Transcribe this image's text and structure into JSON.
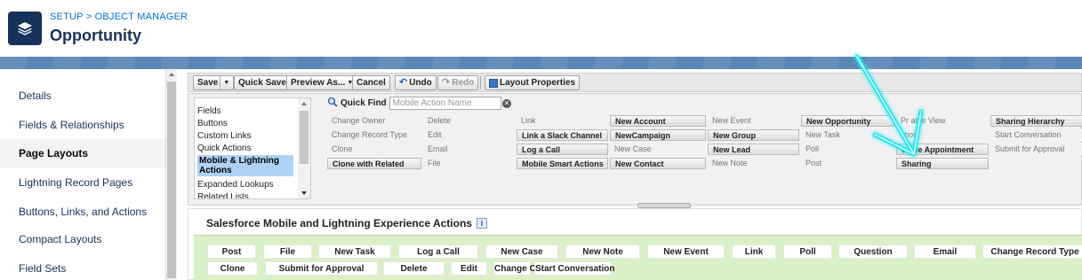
{
  "header": {
    "breadcrumb_setup": "SETUP",
    "breadcrumb_sep": " > ",
    "breadcrumb_om": "OBJECT MANAGER",
    "title": "Opportunity",
    "icon": "layers-icon"
  },
  "sidebar": {
    "items": [
      {
        "label": "Details"
      },
      {
        "label": "Fields & Relationships"
      },
      {
        "label": "Page Layouts"
      },
      {
        "label": "Lightning Record Pages"
      },
      {
        "label": "Buttons, Links, and Actions"
      },
      {
        "label": "Compact Layouts"
      },
      {
        "label": "Field Sets"
      }
    ],
    "active_index": 2
  },
  "toolbar": {
    "save": "Save",
    "quick_save": "Quick Save",
    "preview_as": "Preview As...",
    "cancel": "Cancel",
    "undo": "Undo",
    "redo": "Redo",
    "layout_properties": "Layout Properties"
  },
  "palette": {
    "categories": [
      "Fields",
      "Buttons",
      "Custom Links",
      "Quick Actions",
      "Mobile & Lightning Actions",
      "Expanded Lookups",
      "Related Lists"
    ],
    "selected_category": "Mobile & Lightning Actions",
    "quick_find_label": "Quick Find",
    "quick_find_placeholder": "Mobile Action Name",
    "rows": [
      [
        "Change Owner",
        "Delete",
        "Link",
        "New Account",
        "New Event",
        "New Opportunity",
        "Printable View",
        "Sharing Hierarchy"
      ],
      [
        "Change Record Type",
        "Edit",
        "Link a Slack Channel",
        "NewCampaign",
        "New Group",
        "New Task",
        "Question",
        "Start Conversation"
      ],
      [
        "Clone",
        "Email",
        "Log a Call",
        "New Case",
        "New Lead",
        "Poll",
        "Schedule Appointment",
        "Submit for Approval"
      ],
      [
        "Clone with Related",
        "File",
        "Mobile Smart Actions",
        "New Contact",
        "New Note",
        "Post",
        "Sharing",
        ""
      ]
    ],
    "visible_rows": [
      [
        "Change Owner",
        "Delete",
        "Link",
        "New Account",
        "New Event",
        "New Opportunity",
        "Pr    able View",
        "Sharing Hierarchy"
      ],
      [
        "Change Record Type",
        "Edit",
        "Link a Slack Channel",
        "NewCampaign",
        "New Group",
        "New Task",
        "   stion",
        "Start Conversation"
      ],
      [
        "Clone",
        "Email",
        "Log a Call",
        "New Case",
        "New Lead",
        "Poll",
        "   edule Appointment",
        "Submit for Approval"
      ],
      [
        "Clone with Related",
        "File",
        "Mobile Smart Actions",
        "New Contact",
        "New Note",
        "Post",
        "Sharing",
        ""
      ]
    ],
    "free_cells": [
      [
        0,
        3
      ],
      [
        0,
        5
      ],
      [
        0,
        7
      ],
      [
        1,
        2
      ],
      [
        1,
        3
      ],
      [
        1,
        4
      ],
      [
        2,
        2
      ],
      [
        2,
        4
      ],
      [
        2,
        6
      ],
      [
        3,
        0
      ],
      [
        3,
        2
      ],
      [
        3,
        3
      ],
      [
        3,
        6
      ]
    ]
  },
  "section": {
    "title": "Salesforce Mobile and Lightning Experience Actions",
    "info_icon": "info-icon",
    "row1": [
      "Post",
      "File",
      "New Task",
      "Log a Call",
      "New Case",
      "New Note",
      "New Event",
      "Link",
      "Poll",
      "Question",
      "Email",
      "Change Record Type"
    ],
    "row2": [
      "Clone",
      "Submit for Approval",
      "Delete",
      "Edit",
      "Change Owner",
      "Start Conversation"
    ]
  },
  "overlay": {
    "annotation_color": "#27e6f2",
    "icon": "pointer-arrow-icon"
  }
}
